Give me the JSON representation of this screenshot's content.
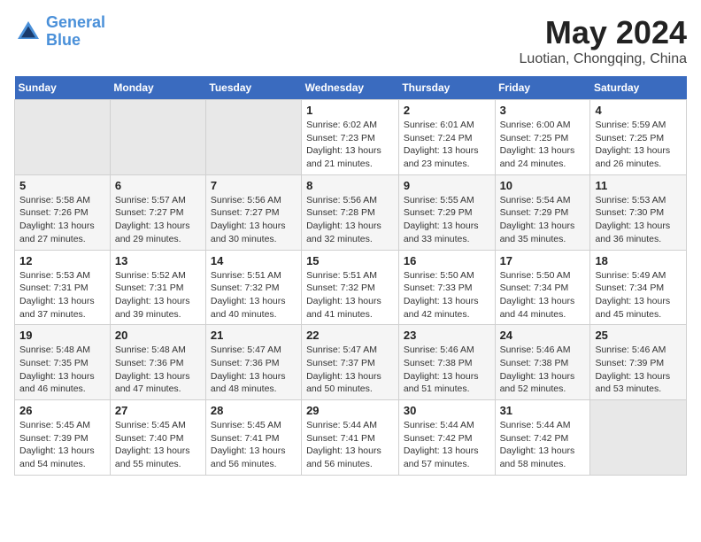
{
  "header": {
    "logo_line1": "General",
    "logo_line2": "Blue",
    "main_title": "May 2024",
    "subtitle": "Luotian, Chongqing, China"
  },
  "weekdays": [
    "Sunday",
    "Monday",
    "Tuesday",
    "Wednesday",
    "Thursday",
    "Friday",
    "Saturday"
  ],
  "weeks": [
    [
      {
        "day": "",
        "info": ""
      },
      {
        "day": "",
        "info": ""
      },
      {
        "day": "",
        "info": ""
      },
      {
        "day": "1",
        "info": "Sunrise: 6:02 AM\nSunset: 7:23 PM\nDaylight: 13 hours and 21 minutes."
      },
      {
        "day": "2",
        "info": "Sunrise: 6:01 AM\nSunset: 7:24 PM\nDaylight: 13 hours and 23 minutes."
      },
      {
        "day": "3",
        "info": "Sunrise: 6:00 AM\nSunset: 7:25 PM\nDaylight: 13 hours and 24 minutes."
      },
      {
        "day": "4",
        "info": "Sunrise: 5:59 AM\nSunset: 7:25 PM\nDaylight: 13 hours and 26 minutes."
      }
    ],
    [
      {
        "day": "5",
        "info": "Sunrise: 5:58 AM\nSunset: 7:26 PM\nDaylight: 13 hours and 27 minutes."
      },
      {
        "day": "6",
        "info": "Sunrise: 5:57 AM\nSunset: 7:27 PM\nDaylight: 13 hours and 29 minutes."
      },
      {
        "day": "7",
        "info": "Sunrise: 5:56 AM\nSunset: 7:27 PM\nDaylight: 13 hours and 30 minutes."
      },
      {
        "day": "8",
        "info": "Sunrise: 5:56 AM\nSunset: 7:28 PM\nDaylight: 13 hours and 32 minutes."
      },
      {
        "day": "9",
        "info": "Sunrise: 5:55 AM\nSunset: 7:29 PM\nDaylight: 13 hours and 33 minutes."
      },
      {
        "day": "10",
        "info": "Sunrise: 5:54 AM\nSunset: 7:29 PM\nDaylight: 13 hours and 35 minutes."
      },
      {
        "day": "11",
        "info": "Sunrise: 5:53 AM\nSunset: 7:30 PM\nDaylight: 13 hours and 36 minutes."
      }
    ],
    [
      {
        "day": "12",
        "info": "Sunrise: 5:53 AM\nSunset: 7:31 PM\nDaylight: 13 hours and 37 minutes."
      },
      {
        "day": "13",
        "info": "Sunrise: 5:52 AM\nSunset: 7:31 PM\nDaylight: 13 hours and 39 minutes."
      },
      {
        "day": "14",
        "info": "Sunrise: 5:51 AM\nSunset: 7:32 PM\nDaylight: 13 hours and 40 minutes."
      },
      {
        "day": "15",
        "info": "Sunrise: 5:51 AM\nSunset: 7:32 PM\nDaylight: 13 hours and 41 minutes."
      },
      {
        "day": "16",
        "info": "Sunrise: 5:50 AM\nSunset: 7:33 PM\nDaylight: 13 hours and 42 minutes."
      },
      {
        "day": "17",
        "info": "Sunrise: 5:50 AM\nSunset: 7:34 PM\nDaylight: 13 hours and 44 minutes."
      },
      {
        "day": "18",
        "info": "Sunrise: 5:49 AM\nSunset: 7:34 PM\nDaylight: 13 hours and 45 minutes."
      }
    ],
    [
      {
        "day": "19",
        "info": "Sunrise: 5:48 AM\nSunset: 7:35 PM\nDaylight: 13 hours and 46 minutes."
      },
      {
        "day": "20",
        "info": "Sunrise: 5:48 AM\nSunset: 7:36 PM\nDaylight: 13 hours and 47 minutes."
      },
      {
        "day": "21",
        "info": "Sunrise: 5:47 AM\nSunset: 7:36 PM\nDaylight: 13 hours and 48 minutes."
      },
      {
        "day": "22",
        "info": "Sunrise: 5:47 AM\nSunset: 7:37 PM\nDaylight: 13 hours and 50 minutes."
      },
      {
        "day": "23",
        "info": "Sunrise: 5:46 AM\nSunset: 7:38 PM\nDaylight: 13 hours and 51 minutes."
      },
      {
        "day": "24",
        "info": "Sunrise: 5:46 AM\nSunset: 7:38 PM\nDaylight: 13 hours and 52 minutes."
      },
      {
        "day": "25",
        "info": "Sunrise: 5:46 AM\nSunset: 7:39 PM\nDaylight: 13 hours and 53 minutes."
      }
    ],
    [
      {
        "day": "26",
        "info": "Sunrise: 5:45 AM\nSunset: 7:39 PM\nDaylight: 13 hours and 54 minutes."
      },
      {
        "day": "27",
        "info": "Sunrise: 5:45 AM\nSunset: 7:40 PM\nDaylight: 13 hours and 55 minutes."
      },
      {
        "day": "28",
        "info": "Sunrise: 5:45 AM\nSunset: 7:41 PM\nDaylight: 13 hours and 56 minutes."
      },
      {
        "day": "29",
        "info": "Sunrise: 5:44 AM\nSunset: 7:41 PM\nDaylight: 13 hours and 56 minutes."
      },
      {
        "day": "30",
        "info": "Sunrise: 5:44 AM\nSunset: 7:42 PM\nDaylight: 13 hours and 57 minutes."
      },
      {
        "day": "31",
        "info": "Sunrise: 5:44 AM\nSunset: 7:42 PM\nDaylight: 13 hours and 58 minutes."
      },
      {
        "day": "",
        "info": ""
      }
    ]
  ]
}
